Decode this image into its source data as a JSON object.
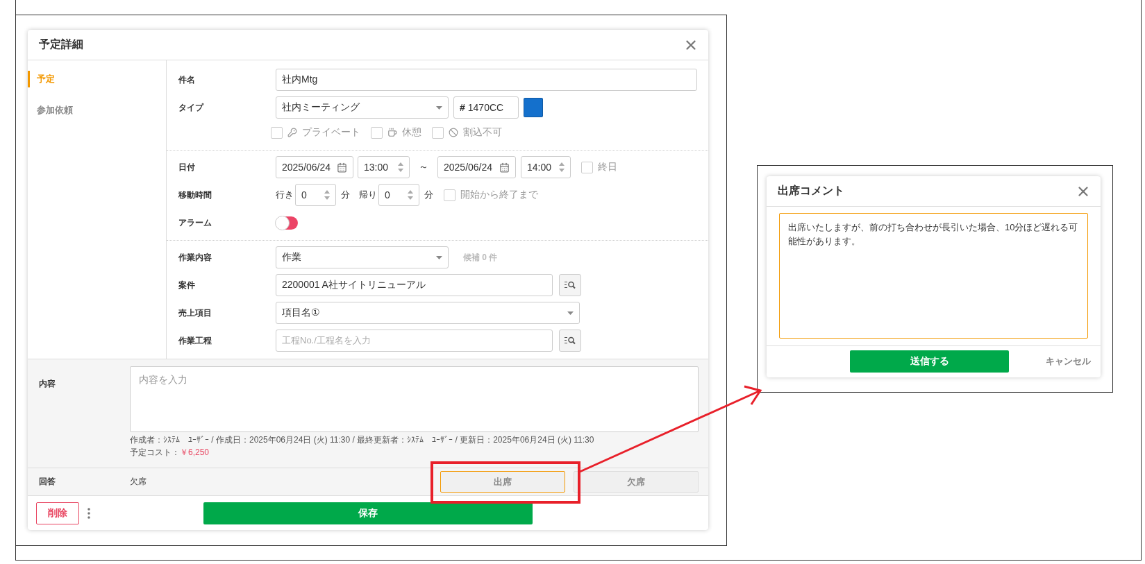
{
  "schedule_dialog": {
    "title": "予定詳細",
    "sidebar": {
      "items": [
        {
          "label": "予定",
          "selected": true
        },
        {
          "label": "参加依頼",
          "selected": false
        }
      ]
    },
    "subject": {
      "label": "件名",
      "value": "社内Mtg"
    },
    "type": {
      "label": "タイプ",
      "value": "社内ミーティング",
      "hex_prefix": "#",
      "hex": "1470CC",
      "color": "#1470cc"
    },
    "flags": [
      {
        "label": "プライベート",
        "checked": false
      },
      {
        "label": "休憩",
        "checked": false
      },
      {
        "label": "割込不可",
        "checked": false
      }
    ],
    "date": {
      "label": "日付",
      "start_date": "2025/06/24",
      "start_time": "13:00",
      "separator": "～",
      "end_date": "2025/06/24",
      "end_time": "14:00",
      "all_day": {
        "label": "終日",
        "checked": false
      }
    },
    "travel": {
      "label": "移動時間",
      "go_label": "行き",
      "go_value": "0",
      "go_unit": "分",
      "return_label": "帰り",
      "return_value": "0",
      "return_unit": "分",
      "span": {
        "label": "開始から終了まで",
        "checked": false
      }
    },
    "alarm": {
      "label": "アラーム",
      "on": false
    },
    "work": {
      "label": "作業内容",
      "value": "作業",
      "candidates": "候補 0 件"
    },
    "project": {
      "label": "案件",
      "value": "2200001 A社サイトリニューアル"
    },
    "sales_item": {
      "label": "売上項目",
      "value": "項目名①"
    },
    "process": {
      "label": "作業工程",
      "placeholder": "工程No./工程名を入力"
    },
    "content": {
      "label": "内容",
      "placeholder": "内容を入力"
    },
    "meta": "作成者：ｼｽﾃﾑ　ﾕｰｻﾞｰ / 作成日：2025年06月24日 (火) 11:30 / 最終更新者：ｼｽﾃﾑ　ﾕｰｻﾞｰ / 更新日：2025年06月24日 (火) 11:30",
    "cost": {
      "label": "予定コスト：",
      "value": "￥6,250"
    },
    "answer": {
      "label": "回答",
      "value": "欠席",
      "options": [
        {
          "label": "出席",
          "highlighted": true
        },
        {
          "label": "欠席",
          "highlighted": false
        }
      ]
    },
    "delete_button": "削除",
    "save_button": "保存"
  },
  "comment_dialog": {
    "title": "出席コメント",
    "comment": "出席いたしますが、前の打ち合わせが長引いた場合、10分ほど遅れる可能性があります。",
    "submit_button": "送信する",
    "cancel_link": "キャンセル"
  }
}
